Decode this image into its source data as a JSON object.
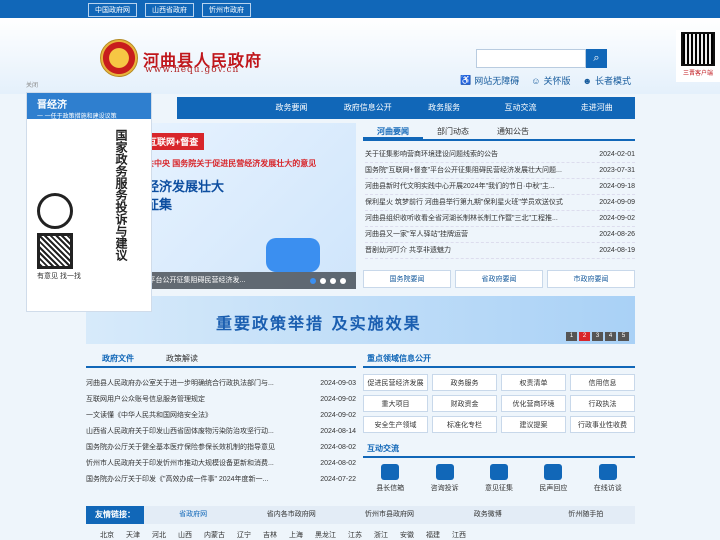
{
  "top_links": [
    "中国政府网",
    "山西省政府",
    "忻州市政府"
  ],
  "site": {
    "title": "河曲县人民政府",
    "url": "www.hequ.gov.cn"
  },
  "search": {
    "placeholder": ""
  },
  "tools": [
    "网站无障碍",
    "关怀版",
    "长者模式"
  ],
  "qr_label": "三晋客户端",
  "nav": [
    "",
    "政务要闻",
    "政府信息公开",
    "政务服务",
    "互动交流",
    "走进河曲"
  ],
  "banner": {
    "label": "互联网+督查",
    "top": "共中央 国务院关于促进民营经济发展壮大的意见",
    "line1": "经济发展壮大",
    "line2": "征集",
    "caption": "\"平台公开征集阻碍民营经济发..."
  },
  "news_tabs": [
    "河曲要闻",
    "部门动态",
    "通知公告"
  ],
  "news": [
    {
      "title": "关于征集影响营商环境建设问题线索的公告",
      "date": "2024-02-01"
    },
    {
      "title": "国务院\"互联网+督查\"平台公开征集阻碍民营经济发展壮大问题...",
      "date": "2023-07-31"
    },
    {
      "title": "河曲县新时代文明实践中心开展2024年\"我们的节日·中秋\"主...",
      "date": "2024-09-18"
    },
    {
      "title": "保利星火 筑梦前行 河曲县举行第九期\"保利星火班\"学员欢送仪式",
      "date": "2024-09-09"
    },
    {
      "title": "河曲县组织收听收看全省河湖长制林长制工作暨\"三北\"工程推...",
      "date": "2024-09-02"
    },
    {
      "title": "河曲县又一家\"军人驿站\"挂牌运营",
      "date": "2024-08-26"
    },
    {
      "title": "晋剧幼河叮介 共享非遗魅力",
      "date": "2024-08-19"
    }
  ],
  "gov_buttons": [
    "国务院要闻",
    "省政府要闻",
    "市政府要闻"
  ],
  "policy": {
    "text": "重要政策举措 及实施效果",
    "pages": [
      "1",
      "2",
      "3",
      "4",
      "5"
    ]
  },
  "doc_tabs": [
    "政府文件",
    "政策解读"
  ],
  "docs": [
    {
      "title": "河曲县人民政府办公室关于进一步明确统合行政执法部门与...",
      "date": "2024-09-03"
    },
    {
      "title": "互联网用户公众账号信息服务管理规定",
      "date": "2024-09-02"
    },
    {
      "title": "一文读懂《中华人民共和国网络安全法》",
      "date": "2024-09-02"
    },
    {
      "title": "山西省人民政府关于印发山西省固体废物污染防治攻坚行动...",
      "date": "2024-08-14"
    },
    {
      "title": "国务院办公厅关于健全基本医疗保险参保长效机制的指导意见",
      "date": "2024-08-02"
    },
    {
      "title": "忻州市人民政府关于印发忻州市推动大规模设备更新和消费...",
      "date": "2024-08-02"
    },
    {
      "title": "国务院办公厅关于印发《\"高效办成一件事\" 2024年度新一...",
      "date": "2024-07-22"
    }
  ],
  "key_section": "重点领域信息公开",
  "key_items": [
    "促进民营经济发展",
    "政务服务",
    "权责清单",
    "信用信息",
    "重大项目",
    "财政资金",
    "优化营商环境",
    "行政执法",
    "安全生产领域",
    "标准化专栏",
    "建议提案",
    "行政事业性收费"
  ],
  "interact_section": "互动交流",
  "interact": [
    "县长信箱",
    "咨询投诉",
    "意见征集",
    "民声回应",
    "在线访谈"
  ],
  "links": {
    "label": "友情链接：",
    "items": [
      "省政府网",
      "省内各市政府网",
      "忻州市县政府网",
      "政务微博",
      "忻州随手拍"
    ]
  },
  "provinces": [
    "北京",
    "天津",
    "河北",
    "山西",
    "内蒙古",
    "辽宁",
    "吉林",
    "上海",
    "黑龙江",
    "江苏",
    "浙江",
    "安徽",
    "福建",
    "江西"
  ],
  "float": {
    "title": "晋经济",
    "sub": "一 一任于政策措施和建设议策",
    "vertical": "国家政务服务投诉与建议",
    "mini": "小程序",
    "close": "关闭",
    "feedback": "有意见 找一找"
  },
  "colors": {
    "primary": "#1167b8",
    "red": "#c0161b"
  }
}
